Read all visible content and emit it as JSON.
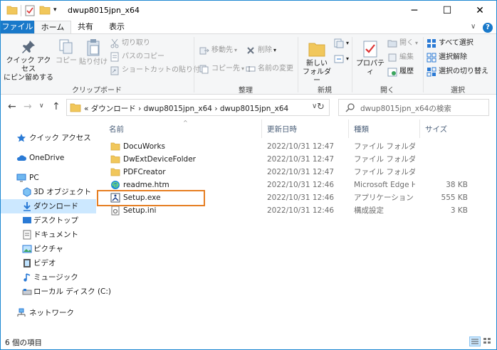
{
  "window": {
    "title": "dwup8015jpn_x64",
    "minimize_glyph": "─",
    "maximize_glyph": "☐",
    "close_glyph": "✕"
  },
  "ribbon_tabs": {
    "file": "ファイル",
    "home": "ホーム",
    "share": "共有",
    "view": "表示"
  },
  "ribbon": {
    "clipboard": {
      "label": "クリップボード",
      "pin_line1": "クイック アクセス",
      "pin_line2": "にピン留めする",
      "copy": "コピー",
      "paste": "貼り付け",
      "cut": "切り取り",
      "copy_path": "パスのコピー",
      "paste_shortcut": "ショートカットの貼り付け"
    },
    "organize": {
      "label": "整理",
      "move_to": "移動先",
      "copy_to": "コピー先",
      "delete": "削除",
      "rename": "名前の変更"
    },
    "new": {
      "label": "新規",
      "new_folder_line1": "新しい",
      "new_folder_line2": "フォルダー"
    },
    "open": {
      "label": "開く",
      "properties": "プロパティ",
      "open": "開く",
      "edit": "編集",
      "history": "履歴"
    },
    "select": {
      "label": "選択",
      "select_all": "すべて選択",
      "select_none": "選択解除",
      "invert": "選択の切り替え"
    }
  },
  "address": {
    "path": "«  ダウンロード  ›  dwup8015jpn_x64  ›  dwup8015jpn_x64",
    "search_placeholder": "dwup8015jpn_x64の検索"
  },
  "nav_pane": {
    "quick_access": "クイック アクセス",
    "onedrive": "OneDrive",
    "pc": "PC",
    "objects3d": "3D オブジェクト",
    "downloads": "ダウンロード",
    "desktop": "デスクトップ",
    "documents": "ドキュメント",
    "pictures": "ピクチャ",
    "videos": "ビデオ",
    "music": "ミュージック",
    "local_disk": "ローカル ディスク (C:)",
    "network": "ネットワーク"
  },
  "columns": {
    "name": "名前",
    "date": "更新日時",
    "type": "種類",
    "size": "サイズ"
  },
  "files": [
    {
      "name": "DocuWorks",
      "date": "2022/10/31 12:47",
      "type": "ファイル フォルダー",
      "size": "",
      "icon": "folder-icon"
    },
    {
      "name": "DwExtDeviceFolder",
      "date": "2022/10/31 12:47",
      "type": "ファイル フォルダー",
      "size": "",
      "icon": "folder-icon"
    },
    {
      "name": "PDFCreator",
      "date": "2022/10/31 12:47",
      "type": "ファイル フォルダー",
      "size": "",
      "icon": "folder-icon"
    },
    {
      "name": "readme.htm",
      "date": "2022/10/31 12:46",
      "type": "Microsoft Edge H...",
      "size": "38 KB",
      "icon": "edge-icon"
    },
    {
      "name": "Setup.exe",
      "date": "2022/10/31 12:46",
      "type": "アプリケーション",
      "size": "555 KB",
      "icon": "setup-exe-icon"
    },
    {
      "name": "Setup.ini",
      "date": "2022/10/31 12:46",
      "type": "構成設定",
      "size": "3 KB",
      "icon": "ini-file-icon"
    }
  ],
  "status": {
    "item_count": "6 個の項目"
  },
  "colors": {
    "accent": "#1979ca",
    "selection": "#cce8ff",
    "highlight_box": "#e67e22",
    "folder": "#f1c75b"
  }
}
